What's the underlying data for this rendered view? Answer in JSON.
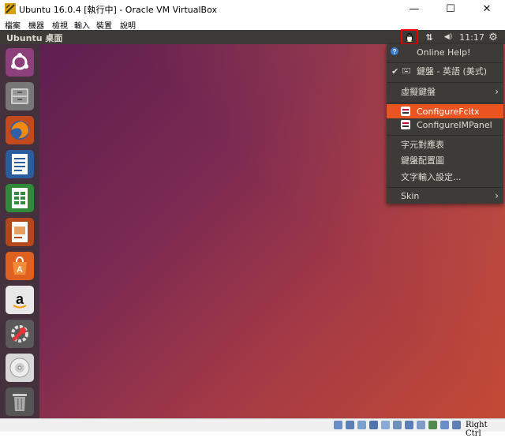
{
  "window": {
    "title": "Ubuntu 16.0.4 [執行中] - Oracle VM VirtualBox",
    "minimize_glyph": "—",
    "maximize_glyph": "☐",
    "close_glyph": "✕"
  },
  "menubar": [
    "檔案",
    "機器",
    "檢視",
    "輸入",
    "裝置",
    "說明"
  ],
  "panel": {
    "title": "Ubuntu 桌面",
    "clock": "11:17",
    "network_glyph": "⇅",
    "volume_glyph": "◀)",
    "gear_glyph": "⚙",
    "fcitx_glyph": "🐧"
  },
  "launcher": {
    "items": [
      "ubuntu-dash",
      "files",
      "firefox",
      "libreoffice-writer",
      "libreoffice-calc",
      "libreoffice-impress",
      "software-center",
      "amazon",
      "system-settings",
      "dvd",
      "trash"
    ]
  },
  "menu": {
    "online_help": "Online Help!",
    "keyboard_en": "鍵盤 - 英語 (美式)",
    "virtual_keyboard": "虛擬鍵盤",
    "configure_fcitx": "ConfigureFcitx",
    "configure_impanel": "ConfigureIMPanel",
    "char_map": "字元對應表",
    "keyboard_layout": "鍵盤配置圖",
    "text_input": "文字輸入設定...",
    "skin": "Skin"
  },
  "statusbar": {
    "host_key": "Right Ctrl"
  },
  "colors": {
    "accent": "#e95420",
    "panel": "#3c3b37",
    "highlight_box": "#ff0000"
  }
}
